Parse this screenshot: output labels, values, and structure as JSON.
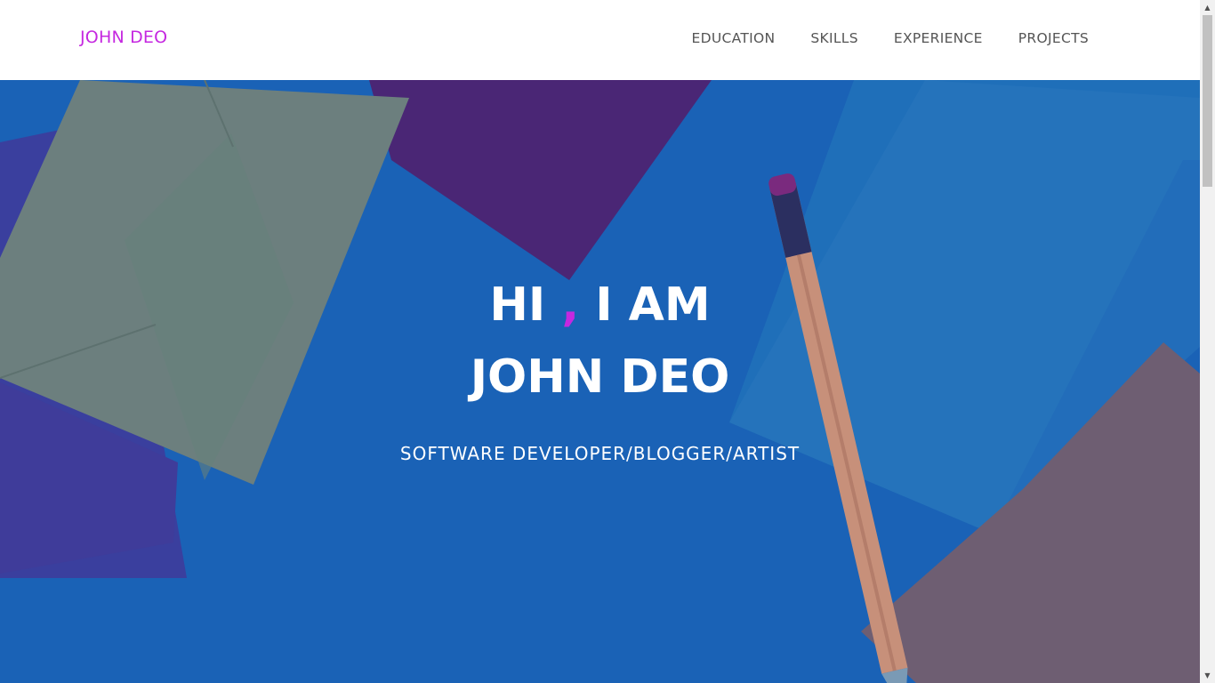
{
  "navbar": {
    "brand": "JOHN DEO",
    "links": [
      "EDUCATION",
      "SKILLS",
      "EXPERIENCE",
      "PROJECTS"
    ]
  },
  "hero": {
    "line1_a": "HI",
    "line1_comma": ",",
    "line1_b": "I AM",
    "line2": "JOHN DEO",
    "subtitle": "SOFTWARE DEVELOPER/BLOGGER/ARTIST"
  },
  "colors": {
    "accent": "#c528e0",
    "hero_overlay": "#1a60b3",
    "nav_text": "#555555"
  },
  "icons": {
    "scroll_up": "triangle-up-icon",
    "scroll_down": "triangle-down-icon"
  }
}
